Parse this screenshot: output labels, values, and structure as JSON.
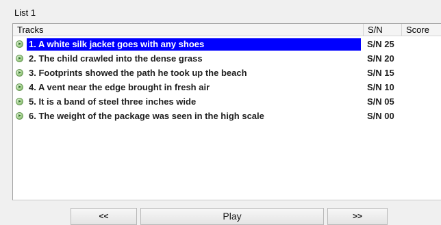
{
  "group": {
    "label": "List 1"
  },
  "list": {
    "columns": {
      "tracks": "Tracks",
      "sn": "S/N",
      "score": "Score"
    },
    "rows": [
      {
        "track": "1. A white silk jacket goes with any shoes",
        "sn": "S/N 25",
        "score": "",
        "selected": true,
        "icon": "play-circle-icon"
      },
      {
        "track": "2. The child crawled into the dense grass",
        "sn": "S/N 20",
        "score": "",
        "selected": false,
        "icon": "play-circle-icon"
      },
      {
        "track": "3. Footprints showed the path he took up the beach",
        "sn": "S/N 15",
        "score": "",
        "selected": false,
        "icon": "play-circle-icon"
      },
      {
        "track": "4. A vent near the edge brought in fresh air",
        "sn": "S/N 10",
        "score": "",
        "selected": false,
        "icon": "play-circle-icon"
      },
      {
        "track": "5. It is a band of steel three inches wide",
        "sn": "S/N 05",
        "score": "",
        "selected": false,
        "icon": "play-circle-icon"
      },
      {
        "track": "6. The weight of the package was seen in the high scale",
        "sn": "S/N 00",
        "score": "",
        "selected": false,
        "icon": "play-circle-icon"
      }
    ]
  },
  "controls": {
    "prev_label": "<<",
    "play_label": "Play",
    "next_label": ">>"
  },
  "colors": {
    "selection": "#0000ff",
    "background": "#f0f0f0"
  }
}
